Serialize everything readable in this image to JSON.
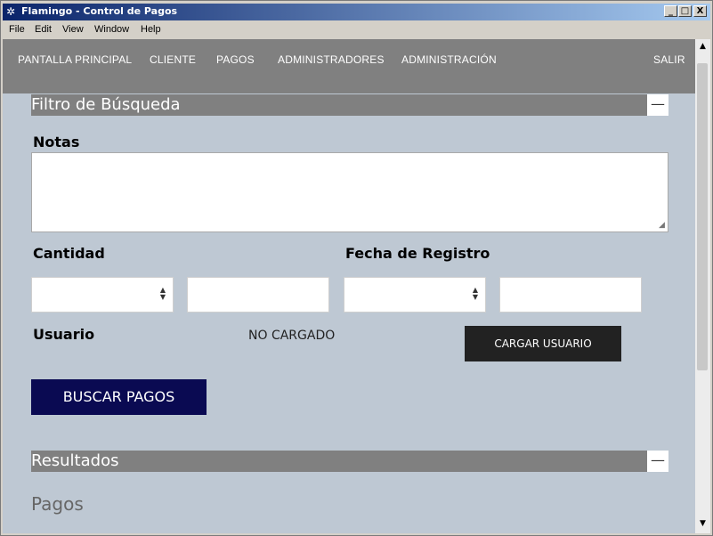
{
  "window": {
    "title": "Flamingo - Control de Pagos",
    "title_icon": "✲",
    "minimize": "_",
    "maximize": "□",
    "close": "X"
  },
  "menubar": [
    "File",
    "Edit",
    "View",
    "Window",
    "Help"
  ],
  "nav": {
    "items": [
      "PANTALLA PRINCIPAL",
      "CLIENTE",
      "PAGOS",
      "ADMINISTRADORES",
      "ADMINISTRACIÓN"
    ],
    "logout": "SALIR"
  },
  "filter": {
    "title": "Filtro de Búsqueda",
    "collapse": "—",
    "notes_label": "Notas",
    "notes_value": "",
    "quantity_label": "Cantidad",
    "quantity_operator": "",
    "quantity_value": "",
    "date_label": "Fecha de Registro",
    "date_operator": "",
    "date_value": "",
    "user_label": "Usuario",
    "user_status": "NO CARGADO",
    "load_user_button": "CARGAR USUARIO",
    "search_button": "BUSCAR PAGOS"
  },
  "results": {
    "title": "Resultados",
    "collapse": "—",
    "subheading": "Pagos"
  },
  "icons": {
    "app": "app-logo-icon",
    "select_arrows": "up-down-arrows-icon",
    "scroll_up": "▲",
    "scroll_down": "▼"
  },
  "colors": {
    "title_bar_start": "#0a246a",
    "title_bar_end": "#a6caf0",
    "nav_background": "#808080",
    "content_background": "#bec8d3",
    "search_button": "#0a0a52",
    "load_user_button": "#222222"
  }
}
